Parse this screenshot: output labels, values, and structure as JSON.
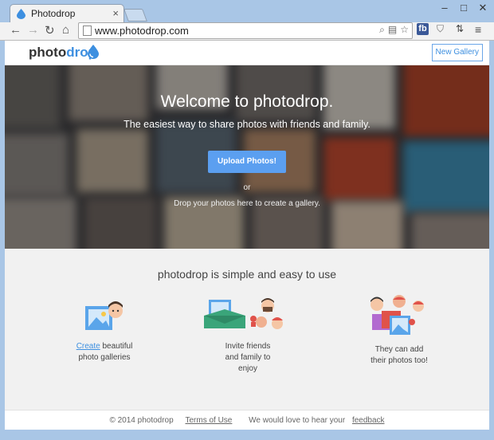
{
  "browser": {
    "tab_title": "Photodrop",
    "url": "www.photodrop.com",
    "colors": {
      "frame": "#a9c6e6",
      "accent": "#3d8fe0"
    }
  },
  "header": {
    "logo_left": "photo",
    "logo_right": "drop",
    "new_gallery_label": "New Gallery"
  },
  "hero": {
    "title": "Welcome to photodrop.",
    "subtitle": "The easiest way to share photos with friends and family.",
    "upload_label": "Upload Photos!",
    "or_text": "or",
    "drop_text": "Drop your photos here to create a gallery."
  },
  "features": {
    "heading": "photodrop is simple and easy to use",
    "items": [
      {
        "link": "Create",
        "line1_rest": " beautiful",
        "line2": "photo galleries",
        "line3": ""
      },
      {
        "link": "",
        "line1_rest": "Invite friends",
        "line2": "and family to",
        "line3": "enjoy"
      },
      {
        "link": "",
        "line1_rest": "They can add",
        "line2": "their photos too!",
        "line3": ""
      }
    ]
  },
  "footer": {
    "copyright": "© 2014 photodrop",
    "terms": "Terms of Use",
    "feedback_prefix": "We would love to hear your ",
    "feedback_link": "feedback"
  }
}
